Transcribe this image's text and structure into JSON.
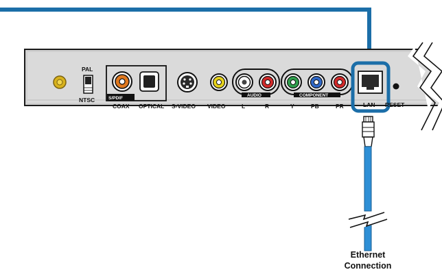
{
  "panel": {
    "switch_top_label": "PAL",
    "switch_bottom_label": "NTSC",
    "spdif_tag": "S/PDIF",
    "coax_label": "COAX",
    "optical_label": "OPTICAL",
    "svideo_label": "S-VIDEO",
    "video_label": "VIDEO",
    "audio_group_label": "AUDIO",
    "audio_left_label": "L",
    "audio_right_label": "R",
    "component_group_label": "COMPONENT",
    "y_label": "Y",
    "pb_label": "PB",
    "pr_label": "PR",
    "lan_label": "LAN",
    "reset_label": "RESET"
  },
  "cable": {
    "caption_line1": "Ethernet",
    "caption_line2": "Connection"
  },
  "colors": {
    "highlight_blue": "#1b6ea8",
    "cable_blue": "#2e8fd6",
    "panel_fill": "#d9d9d9",
    "antenna_gold": "#d8b21d",
    "video_yellow": "#e6d21a",
    "audio_right_red": "#d22a2a",
    "y_green": "#2f9e4c",
    "pb_blue": "#2f68c8",
    "pr_red": "#d22a2a",
    "coax_orange": "#e0781e"
  },
  "icons": [
    "antenna-connector-icon",
    "toggle-switch-icon",
    "rca-jack-icon",
    "optical-port-icon",
    "svideo-port-icon",
    "rj45-port-icon",
    "reset-button-icon",
    "ethernet-plug-icon",
    "cable-break-icon"
  ]
}
